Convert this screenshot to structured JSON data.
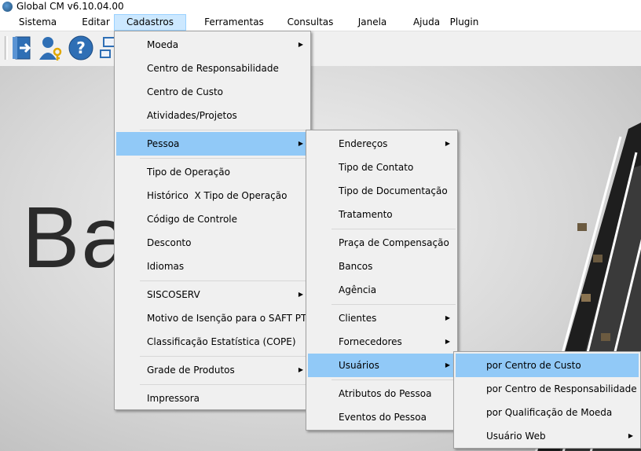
{
  "window": {
    "title": "Global CM v6.10.04.00"
  },
  "menubar": {
    "items": [
      "Sistema",
      "Editar",
      "Cadastros",
      "Ferramentas",
      "Consultas",
      "Janela",
      "Ajuda",
      "Plugin"
    ],
    "active": "Cadastros"
  },
  "toolbar": {
    "icons": [
      "exit-door-icon",
      "user-key-icon",
      "help-icon",
      "network-icon"
    ]
  },
  "background": {
    "text": "Ba          ão"
  },
  "cadastros_menu": {
    "items": [
      {
        "label": "Moeda",
        "submenu": true
      },
      {
        "label": "Centro de Responsabilidade"
      },
      {
        "label": "Centro de Custo"
      },
      {
        "label": "Atividades/Projetos"
      },
      {
        "label": "Pessoa",
        "submenu": true,
        "highlighted": true
      },
      {
        "label": "Tipo de Operação"
      },
      {
        "label": "Histórico  X Tipo de Operação"
      },
      {
        "label": "Código de Controle"
      },
      {
        "label": "Desconto"
      },
      {
        "label": "Idiomas"
      },
      {
        "label": "SISCOSERV",
        "submenu": true
      },
      {
        "label": "Motivo de Isenção para o SAFT PT"
      },
      {
        "label": "Classificação Estatística (COPE)"
      },
      {
        "label": "Grade de Produtos",
        "submenu": true
      },
      {
        "label": "Impressora"
      }
    ]
  },
  "pessoa_menu": {
    "items": [
      {
        "label": "Endereços",
        "submenu": true
      },
      {
        "label": "Tipo de Contato"
      },
      {
        "label": "Tipo de Documentação"
      },
      {
        "label": "Tratamento"
      },
      {
        "label": "Praça de Compensação"
      },
      {
        "label": "Bancos"
      },
      {
        "label": "Agência"
      },
      {
        "label": "Clientes",
        "submenu": true
      },
      {
        "label": "Fornecedores",
        "submenu": true
      },
      {
        "label": "Usuários",
        "submenu": true,
        "highlighted": true
      },
      {
        "label": "Atributos do Pessoa"
      },
      {
        "label": "Eventos do Pessoa"
      }
    ]
  },
  "usuarios_menu": {
    "items": [
      {
        "label": "por Centro de Custo",
        "highlighted": true
      },
      {
        "label": "por Centro de Responsabilidade"
      },
      {
        "label": "por Qualificação de Moeda"
      },
      {
        "label": "Usuário Web",
        "submenu": true
      }
    ]
  },
  "colors": {
    "highlight": "#91c9f7",
    "menu_bg": "#f0f0f0",
    "menubar_active": "#cce8ff"
  }
}
